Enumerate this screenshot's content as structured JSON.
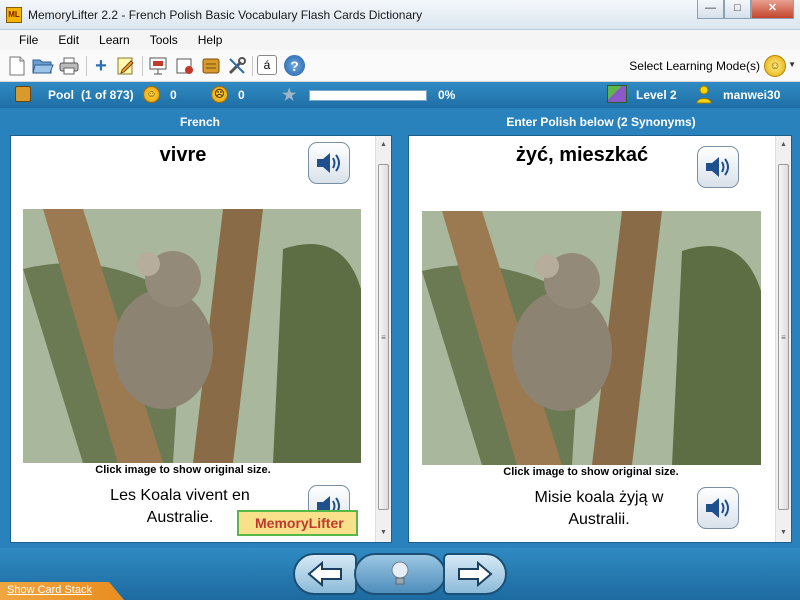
{
  "window": {
    "app_icon": "ML",
    "title": "MemoryLifter 2.2 - French Polish Basic Vocabulary Flash Cards Dictionary",
    "minimize": "—",
    "maximize": "□",
    "close": "✕"
  },
  "menu": [
    "File",
    "Edit",
    "Learn",
    "Tools",
    "Help"
  ],
  "toolbar": {
    "icons": [
      "new-document-icon",
      "open-folder-icon",
      "print-icon",
      "add-card-icon",
      "edit-notepad-icon",
      "presentation-icon",
      "statistics-icon",
      "box-icon",
      "tools-icon",
      "special-char-icon",
      "help-icon"
    ],
    "special_char_glyph": "á",
    "help_glyph": "?",
    "learning_mode_label": "Select Learning Mode(s)"
  },
  "status": {
    "pool_label": "Pool",
    "pool_count": "(1 of 873)",
    "happy_count": "0",
    "sad_count": "0",
    "progress_percent": 0,
    "progress_text": "0%",
    "level": "Level 2",
    "username": "manwei30"
  },
  "question": {
    "header": "French",
    "word": "vivre",
    "image_caption": "Click image to show original size.",
    "sentence_line1": "Les Koala vivent en",
    "sentence_line2": "Australie.",
    "watermark": "MemoryLifter"
  },
  "answer": {
    "header": "Enter Polish below (2 Synonyms)",
    "word": "żyć, mieszkać",
    "image_caption": "Click image to show original size.",
    "sentence_line1": "Misie koala żyją w",
    "sentence_line2": "Australii."
  },
  "bottom": {
    "show_card_stack": "Show Card Stack"
  },
  "colors": {
    "accent_blue": "#2a82bd",
    "status_blue": "#1f6fa6",
    "orange_tab": "#e98d1f"
  }
}
